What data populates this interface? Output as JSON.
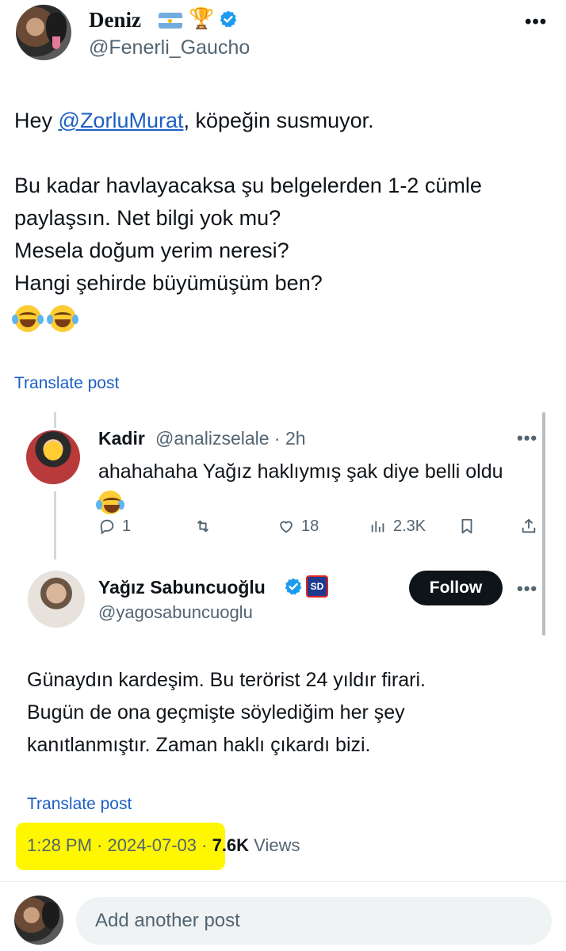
{
  "author": {
    "display_name": "Deniz",
    "handle": "@Fenerli_Gaucho",
    "icons": [
      "argentina-flag-icon",
      "trophy-icon",
      "verified-icon"
    ]
  },
  "post": {
    "line1_prefix": "Hey ",
    "mention": "@ZorluMurat",
    "line1_suffix": ", köpeğin susmuyor.",
    "line2": "Bu kadar havlayacaksa şu belgelerden 1-2 cümle",
    "line3": "paylaşsın. Net bilgi yok mu?",
    "line4": "Mesela doğum yerim neresi?",
    "line5": "Hangi şehirde büyümüşüm ben?",
    "emoji": "tears-of-joy-icon x2",
    "translate_label": "Translate post"
  },
  "reply": {
    "name": "Kadir",
    "meta": "@analizselale · 2h",
    "text": "ahahahaha Yağız haklıymış şak diye belli oldu",
    "replies": "1",
    "likes": "18",
    "views": "2.3K"
  },
  "quoted": {
    "name": "Yağız Sabuncuoğlu",
    "badge": "SD",
    "handle": "@yagosabuncuoglu",
    "follow_label": "Follow",
    "line1": "Günaydın kardeşim. Bu terörist 24 yıldır firari.",
    "line2": "Bugün de ona geçmişte söylediğim her şey",
    "line3": "kanıtlanmıştır. Zaman haklı çıkardı bizi.",
    "translate_label": "Translate post",
    "timestamp": "1:28 PM · 2024-07-03 · ",
    "views_count": "7.6K",
    "views_label": " Views"
  },
  "compose": {
    "placeholder": "Add another post"
  },
  "colors": {
    "link": "#1d5fc4",
    "highlight": "#fff700",
    "text": "#0f1419",
    "muted": "#536471"
  }
}
